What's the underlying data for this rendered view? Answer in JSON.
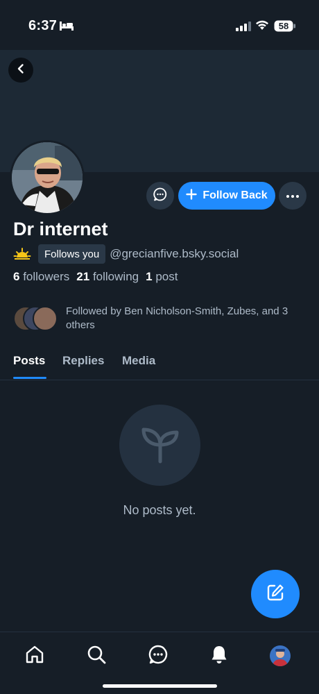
{
  "status_bar": {
    "time": "6:37",
    "battery": "58",
    "icons": [
      "bed-icon",
      "signal-icon",
      "wifi-icon",
      "battery-icon"
    ]
  },
  "profile": {
    "display_name": "Dr internet",
    "follows_you_badge": "Follows you",
    "handle": "@grecianfive.bsky.social",
    "followers_count": "6",
    "followers_label": "followers",
    "following_count": "21",
    "following_label": "following",
    "posts_count": "1",
    "posts_label": "post",
    "followed_by_text": "Followed by Ben Nicholson-Smith, Zubes, and 3 others"
  },
  "actions": {
    "follow_back_label": "Follow Back",
    "icons": [
      "message-icon",
      "plus-icon",
      "more-dots-icon",
      "back-arrow-icon"
    ]
  },
  "tabs": [
    {
      "label": "Posts",
      "active": true
    },
    {
      "label": "Replies",
      "active": false
    },
    {
      "label": "Media",
      "active": false
    }
  ],
  "empty_state": {
    "icon": "sprout-icon",
    "message": "No posts yet."
  },
  "fab": {
    "icon": "compose-icon"
  },
  "bottom_nav": [
    "home-icon",
    "search-icon",
    "chat-icon",
    "bell-icon",
    "profile-avatar"
  ],
  "colors": {
    "background": "#161e27",
    "banner": "#1d2935",
    "accent": "#208bfe",
    "muted_text": "#aebbc9",
    "surface": "#2a3847"
  }
}
